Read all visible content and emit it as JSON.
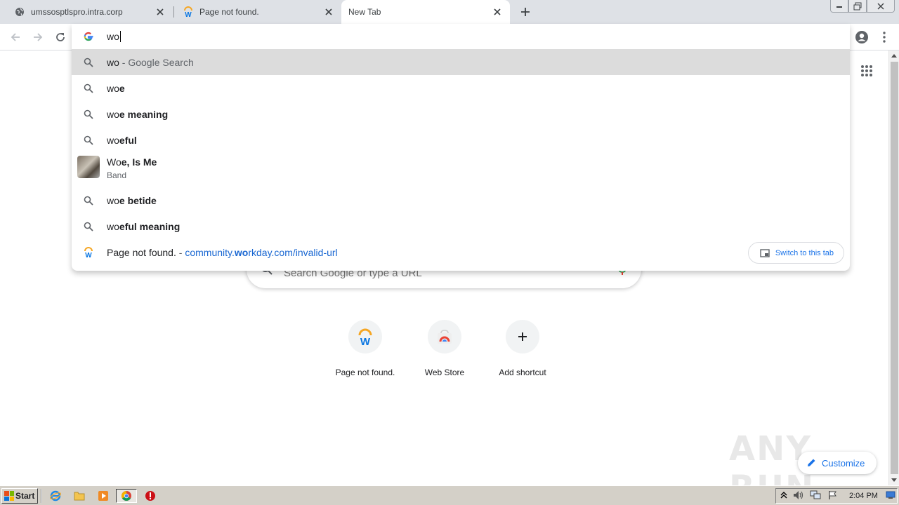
{
  "tabs": [
    {
      "title": "umssosptlspro.intra.corp",
      "icon": "globe-icon"
    },
    {
      "title": "Page not found.",
      "icon": "workday-icon"
    },
    {
      "title": "New Tab",
      "icon": "none"
    }
  ],
  "omnibox": {
    "value": "wo",
    "suggestions": [
      {
        "type": "search",
        "pre": "wo",
        "post": "",
        "suffix": " - Google Search",
        "selected": true
      },
      {
        "type": "search",
        "pre": "wo",
        "post": "e",
        "suffix": ""
      },
      {
        "type": "search",
        "pre": "wo",
        "post": "e meaning",
        "suffix": ""
      },
      {
        "type": "search",
        "pre": "wo",
        "post": "eful",
        "suffix": ""
      },
      {
        "type": "entity",
        "pre": "Wo",
        "post": "e, Is Me",
        "subtitle": "Band"
      },
      {
        "type": "search",
        "pre": "wo",
        "post": "e betide",
        "suffix": ""
      },
      {
        "type": "search",
        "pre": "wo",
        "post": "eful meaning",
        "suffix": ""
      }
    ],
    "tab_match": {
      "title": "Page not found.",
      "sep": " - ",
      "url_pre": "community.",
      "url_bold": "wo",
      "url_post": "rkday.com/invalid-url",
      "button": "Switch to this tab"
    }
  },
  "ntp": {
    "search_placeholder": "Search Google or type a URL",
    "shortcuts": [
      {
        "label": "Page not found.",
        "icon": "workday-icon"
      },
      {
        "label": "Web Store",
        "icon": "webstore-icon"
      },
      {
        "label": "Add shortcut",
        "icon": "plus-icon"
      }
    ],
    "customize": "Customize",
    "watermark": "ANY RUN"
  },
  "taskbar": {
    "start": "Start",
    "clock": "2:04 PM"
  },
  "colors": {
    "accent": "#1a73e8",
    "tabstrip": "#dee1e6",
    "selected_row": "#dcdcdc",
    "taskbar": "#d4d0c8"
  }
}
